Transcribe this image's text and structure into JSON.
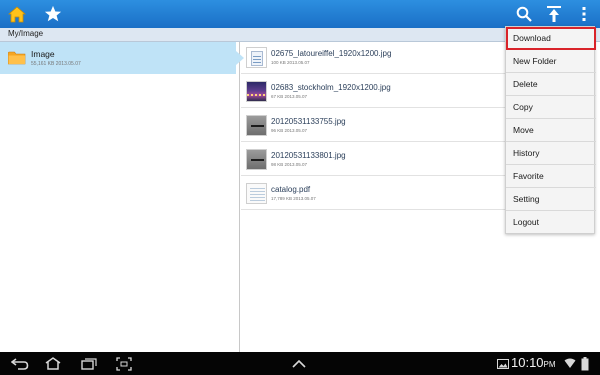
{
  "breadcrumb": {
    "path": "My/Image"
  },
  "folders": [
    {
      "name": "Image",
      "meta": "55,161 KB  2013.05.07",
      "icon": "folder-icon"
    }
  ],
  "files": [
    {
      "name": "02675_latoureiffel_1920x1200.jpg",
      "meta": "100 KB  2013.05.07",
      "thumb": "doc"
    },
    {
      "name": "02683_stockholm_1920x1200.jpg",
      "meta": "67 KB  2013.05.07",
      "thumb": "photo"
    },
    {
      "name": "20120531133755.jpg",
      "meta": "96 KB  2013.05.07",
      "thumb": "grey"
    },
    {
      "name": "20120531133801.jpg",
      "meta": "98 KB  2013.05.07",
      "thumb": "grey"
    },
    {
      "name": "catalog.pdf",
      "meta": "17,789 KB  2013.05.07",
      "thumb": "pdf"
    }
  ],
  "menu": {
    "items": [
      "Download",
      "New Folder",
      "Delete",
      "Copy",
      "Move",
      "History",
      "Favorite",
      "Setting",
      "Logout"
    ],
    "highlighted": "Download"
  },
  "status": {
    "time": "10:10",
    "ampm": "PM"
  },
  "colors": {
    "topbar": "#1a6fc6",
    "selection": "#bfe3f7",
    "highlight_border": "#d9232a"
  },
  "icons": {
    "topbar": [
      "home-icon",
      "star-icon",
      "search-icon",
      "upload-icon",
      "overflow-menu-icon"
    ],
    "sysbar": [
      "back-icon",
      "home-nav-icon",
      "recent-apps-icon",
      "screenshot-icon",
      "expand-icon",
      "gallery-icon",
      "wifi-icon",
      "battery-icon"
    ]
  }
}
